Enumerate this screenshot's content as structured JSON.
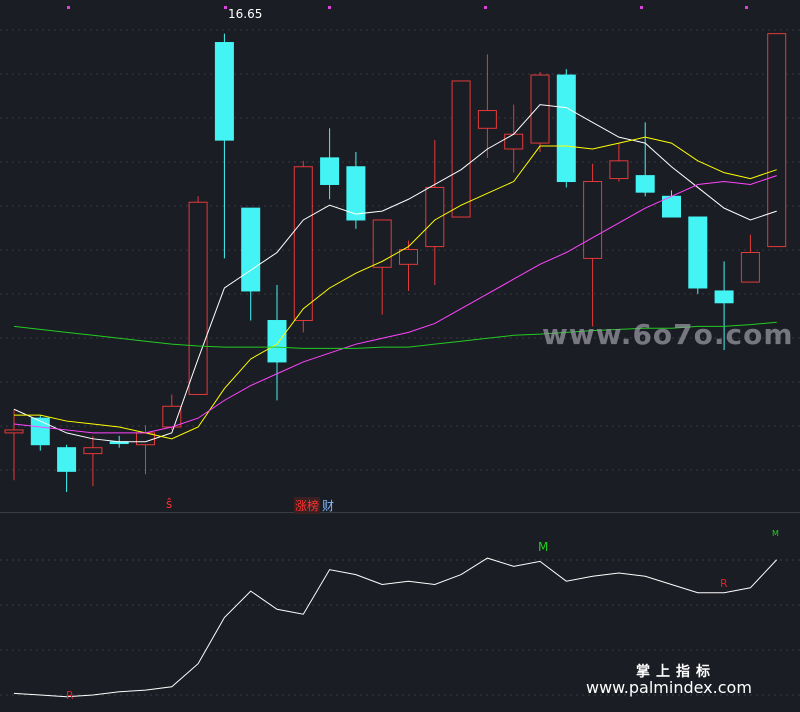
{
  "chart_data": [
    {
      "type": "candlestick",
      "max_label": "16.65",
      "ylim": [
        9.0,
        17.2
      ],
      "candles": [
        {
          "o": 10.05,
          "h": 10.45,
          "l": 9.25,
          "c": 10.1
        },
        {
          "o": 10.3,
          "h": 10.35,
          "l": 9.75,
          "c": 9.85
        },
        {
          "o": 9.8,
          "h": 9.85,
          "l": 9.05,
          "c": 9.4
        },
        {
          "o": 9.7,
          "h": 10.0,
          "l": 9.15,
          "c": 9.8
        },
        {
          "o": 9.9,
          "h": 10.0,
          "l": 9.8,
          "c": 9.87
        },
        {
          "o": 9.85,
          "h": 10.18,
          "l": 9.35,
          "c": 10.05
        },
        {
          "o": 10.15,
          "h": 10.7,
          "l": 10.1,
          "c": 10.5
        },
        {
          "o": 10.7,
          "h": 14.05,
          "l": 10.7,
          "c": 13.95
        },
        {
          "o": 16.65,
          "h": 16.8,
          "l": 13.0,
          "c": 15.0
        },
        {
          "o": 13.85,
          "h": 13.85,
          "l": 11.95,
          "c": 12.45
        },
        {
          "o": 11.95,
          "h": 12.55,
          "l": 10.6,
          "c": 11.25
        },
        {
          "o": 11.95,
          "h": 14.65,
          "l": 11.75,
          "c": 14.55
        },
        {
          "o": 14.7,
          "h": 15.2,
          "l": 14.0,
          "c": 14.25
        },
        {
          "o": 14.55,
          "h": 14.8,
          "l": 13.5,
          "c": 13.65
        },
        {
          "o": 12.85,
          "h": 13.65,
          "l": 12.05,
          "c": 13.65
        },
        {
          "o": 12.9,
          "h": 13.3,
          "l": 12.45,
          "c": 13.15
        },
        {
          "o": 13.2,
          "h": 15.0,
          "l": 12.55,
          "c": 14.2
        },
        {
          "o": 13.7,
          "h": 16.0,
          "l": 13.7,
          "c": 16.0
        },
        {
          "o": 15.2,
          "h": 16.45,
          "l": 14.7,
          "c": 15.5
        },
        {
          "o": 14.85,
          "h": 15.6,
          "l": 14.45,
          "c": 15.1
        },
        {
          "o": 14.95,
          "h": 16.15,
          "l": 14.8,
          "c": 16.1
        },
        {
          "o": 16.1,
          "h": 16.2,
          "l": 14.2,
          "c": 14.3
        },
        {
          "o": 13.0,
          "h": 14.6,
          "l": 11.85,
          "c": 14.3
        },
        {
          "o": 14.35,
          "h": 14.95,
          "l": 14.3,
          "c": 14.65
        },
        {
          "o": 14.4,
          "h": 15.3,
          "l": 14.05,
          "c": 14.12
        },
        {
          "o": 14.05,
          "h": 14.15,
          "l": 13.7,
          "c": 13.7
        },
        {
          "o": 13.7,
          "h": 13.7,
          "l": 12.4,
          "c": 12.5
        },
        {
          "o": 12.45,
          "h": 12.95,
          "l": 11.45,
          "c": 12.25
        },
        {
          "o": 12.6,
          "h": 13.4,
          "l": 12.6,
          "c": 13.1
        },
        {
          "o": 13.2,
          "h": 16.8,
          "l": 13.2,
          "c": 16.8
        }
      ],
      "series": [
        {
          "color": "#ffffff",
          "values": [
            10.45,
            10.25,
            10.05,
            9.95,
            9.9,
            9.9,
            10.05,
            11.3,
            12.5,
            12.8,
            13.1,
            13.65,
            13.9,
            13.75,
            13.8,
            14.0,
            14.25,
            14.5,
            14.85,
            15.1,
            15.6,
            15.55,
            15.3,
            15.05,
            14.95,
            14.55,
            14.2,
            13.85,
            13.65,
            13.8
          ]
        },
        {
          "color": "#ffff00",
          "values": [
            10.35,
            10.35,
            10.25,
            10.2,
            10.15,
            10.05,
            9.95,
            10.15,
            10.8,
            11.3,
            11.55,
            12.15,
            12.5,
            12.75,
            12.95,
            13.2,
            13.65,
            13.9,
            14.1,
            14.3,
            14.9,
            14.9,
            14.85,
            14.95,
            15.05,
            14.95,
            14.65,
            14.45,
            14.35,
            14.5
          ]
        },
        {
          "color": "#ff44ff",
          "values": [
            10.2,
            10.15,
            10.1,
            10.05,
            10.05,
            10.05,
            10.15,
            10.3,
            10.6,
            10.85,
            11.05,
            11.25,
            11.4,
            11.55,
            11.65,
            11.75,
            11.9,
            12.15,
            12.4,
            12.65,
            12.9,
            13.1,
            13.35,
            13.6,
            13.85,
            14.05,
            14.25,
            14.3,
            14.25,
            14.4
          ]
        },
        {
          "color": "#22cc22",
          "values": [
            11.85,
            11.8,
            11.75,
            11.7,
            11.65,
            11.6,
            11.55,
            11.52,
            11.5,
            11.5,
            11.5,
            11.48,
            11.48,
            11.48,
            11.5,
            11.5,
            11.55,
            11.6,
            11.65,
            11.7,
            11.72,
            11.75,
            11.78,
            11.8,
            11.82,
            11.82,
            11.85,
            11.85,
            11.88,
            11.92
          ]
        }
      ]
    },
    {
      "type": "line",
      "ylim": [
        0,
        100
      ],
      "series": [
        {
          "color": "#ffffff",
          "values": [
            4,
            3,
            2,
            3,
            5,
            6,
            8,
            22,
            50,
            66,
            55,
            52,
            79,
            76,
            70,
            72,
            70,
            76,
            86,
            81,
            84,
            72,
            75,
            77,
            75,
            70,
            65,
            65,
            68,
            85
          ]
        }
      ]
    }
  ],
  "signals": {
    "s_label": "ŝ",
    "tag_zhang": "涨榜",
    "tag_cai": "财",
    "m_label": "M",
    "r_label": "R",
    "m_small": "M"
  },
  "watermarks": {
    "site1": "www.6o7o.com",
    "brand_cn": "掌上指标",
    "site2": "www.palmindex.com"
  }
}
